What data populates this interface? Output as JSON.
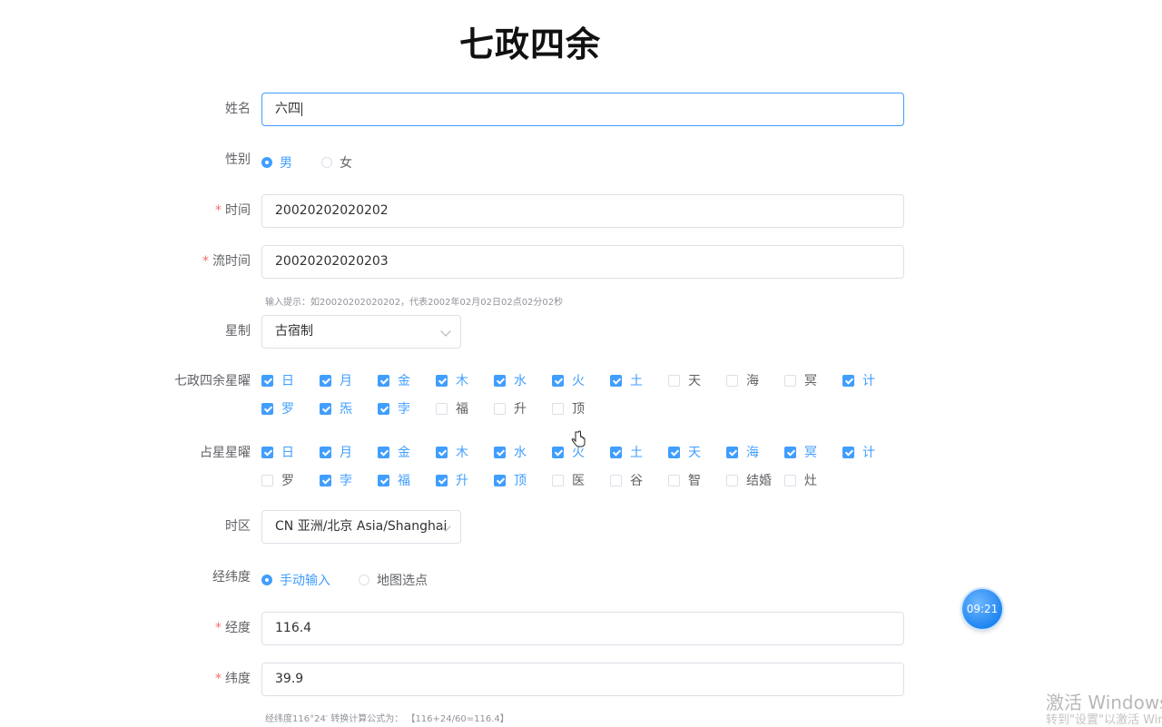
{
  "title": "七政四余",
  "form": {
    "name": {
      "label": "姓名",
      "value": "六四"
    },
    "gender": {
      "label": "性别",
      "options": [
        "男",
        "女"
      ],
      "selected": "男"
    },
    "time": {
      "label": "时间",
      "value": "20020202020202"
    },
    "flow_time": {
      "label": "流时间",
      "value": "20020202020203"
    },
    "time_hint": "输入提示：如20020202020202，代表2002年02月02日02点02分02秒",
    "star_system": {
      "label": "星制",
      "value": "古宿制"
    },
    "qizheng_stars": {
      "label": "七政四余星曜",
      "items": [
        {
          "label": "日",
          "checked": true
        },
        {
          "label": "月",
          "checked": true
        },
        {
          "label": "金",
          "checked": true
        },
        {
          "label": "木",
          "checked": true
        },
        {
          "label": "水",
          "checked": true
        },
        {
          "label": "火",
          "checked": true
        },
        {
          "label": "土",
          "checked": true
        },
        {
          "label": "天",
          "checked": false
        },
        {
          "label": "海",
          "checked": false
        },
        {
          "label": "冥",
          "checked": false
        },
        {
          "label": "计",
          "checked": true
        },
        {
          "label": "罗",
          "checked": true
        },
        {
          "label": "炁",
          "checked": true
        },
        {
          "label": "孛",
          "checked": true
        },
        {
          "label": "福",
          "checked": false
        },
        {
          "label": "升",
          "checked": false
        },
        {
          "label": "顶",
          "checked": false
        }
      ]
    },
    "zhanxing_stars": {
      "label": "占星星曜",
      "items": [
        {
          "label": "日",
          "checked": true
        },
        {
          "label": "月",
          "checked": true
        },
        {
          "label": "金",
          "checked": true
        },
        {
          "label": "木",
          "checked": true
        },
        {
          "label": "水",
          "checked": true
        },
        {
          "label": "火",
          "checked": true
        },
        {
          "label": "土",
          "checked": true
        },
        {
          "label": "天",
          "checked": true
        },
        {
          "label": "海",
          "checked": true
        },
        {
          "label": "冥",
          "checked": true
        },
        {
          "label": "计",
          "checked": true
        },
        {
          "label": "罗",
          "checked": false
        },
        {
          "label": "孛",
          "checked": true
        },
        {
          "label": "福",
          "checked": true
        },
        {
          "label": "升",
          "checked": true
        },
        {
          "label": "顶",
          "checked": true
        },
        {
          "label": "医",
          "checked": false
        },
        {
          "label": "谷",
          "checked": false
        },
        {
          "label": "智",
          "checked": false
        },
        {
          "label": "结婚",
          "checked": false
        },
        {
          "label": "灶",
          "checked": false
        }
      ]
    },
    "timezone": {
      "label": "时区",
      "value": "CN 亚洲/北京 Asia/Shanghai"
    },
    "coords": {
      "label": "经纬度",
      "options": [
        "手动输入",
        "地图选点"
      ],
      "selected": "手动输入"
    },
    "longitude": {
      "label": "经度",
      "value": "116.4"
    },
    "latitude": {
      "label": "纬度",
      "value": "39.9"
    },
    "coord_hint": "经纬度116°24′ 转换计算公式为： 【116+24/60=116.4】"
  },
  "timer": "09:21",
  "watermark": {
    "line1": "激活 Windows",
    "line2": "转到\"设置\"以激活 Windows。"
  },
  "colors": {
    "primary": "#409eff",
    "required": "#f56c6c",
    "border": "#dcdfe6"
  }
}
